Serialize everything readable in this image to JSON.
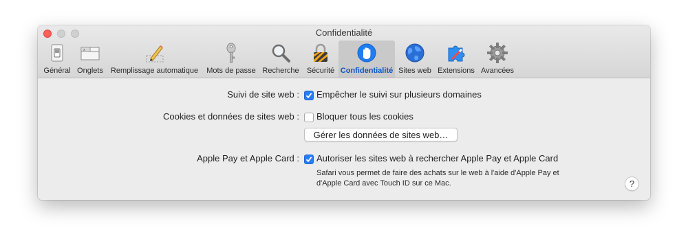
{
  "window": {
    "title": "Confidentialité"
  },
  "toolbar": {
    "items": [
      {
        "label": "Général",
        "icon": "general-switch-icon"
      },
      {
        "label": "Onglets",
        "icon": "tabs-icon"
      },
      {
        "label": "Remplissage automatique",
        "icon": "pencil-icon"
      },
      {
        "label": "Mots de passe",
        "icon": "key-icon"
      },
      {
        "label": "Recherche",
        "icon": "magnifier-icon"
      },
      {
        "label": "Sécurité",
        "icon": "padlock-icon"
      },
      {
        "label": "Confidentialité",
        "icon": "hand-icon",
        "selected": true
      },
      {
        "label": "Sites web",
        "icon": "globe-icon"
      },
      {
        "label": "Extensions",
        "icon": "puzzle-icon"
      },
      {
        "label": "Avancées",
        "icon": "gear-icon"
      }
    ]
  },
  "tracking": {
    "label": "Suivi de site web :",
    "checkbox_label": "Empêcher le suivi sur plusieurs domaines",
    "checked": true
  },
  "cookies": {
    "label": "Cookies et données de sites web :",
    "checkbox_label": "Bloquer tous les cookies",
    "checked": false,
    "manage_button": "Gérer les données de sites web…"
  },
  "applepay": {
    "label": "Apple Pay et Apple Card :",
    "checkbox_label": "Autoriser les sites web à rechercher Apple Pay et Apple Card",
    "checked": true,
    "note_line1": "Safari vous permet de faire des achats sur le web à l'aide d'Apple Pay et",
    "note_line2": "d'Apple Card avec Touch ID sur ce Mac."
  },
  "help": {
    "label": "?"
  },
  "colors": {
    "accent": "#2b7cf4",
    "selected_label": "#0b55c4",
    "close": "#ff5f57"
  }
}
